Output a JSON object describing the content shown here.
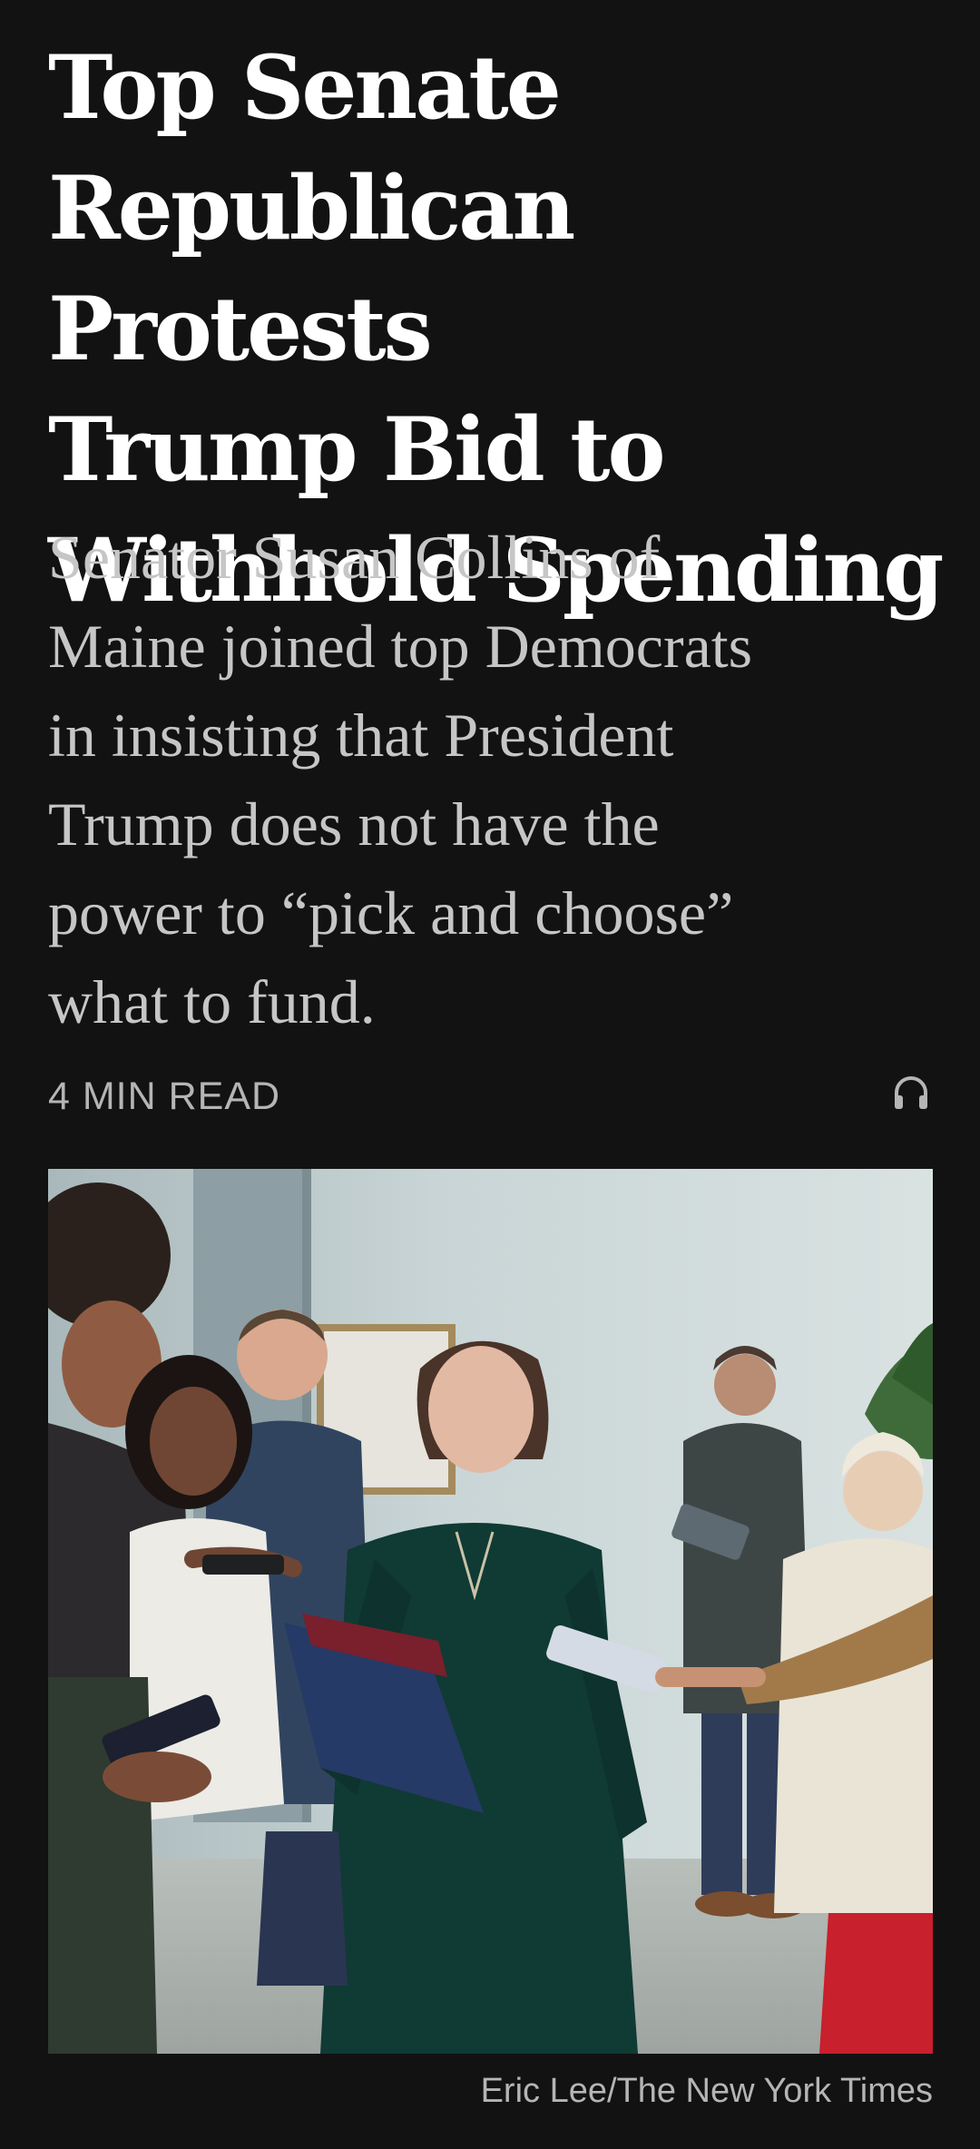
{
  "article": {
    "headline_lines": [
      "Top Senate",
      "Republican Protests",
      "Trump Bid to",
      "Withhold Spending"
    ],
    "summary_lines": [
      "Senator Susan Collins of",
      "Maine joined top Democrats",
      "in insisting that President",
      "Trump does not have the",
      "power to “pick and choose”",
      "what to fund."
    ],
    "read_time": "4 MIN READ",
    "listen_icon": "headphones-icon",
    "photo_credit": "Eric Lee/The New York Times"
  },
  "colors": {
    "background": "#121212",
    "headline": "#ffffff",
    "summary": "#c6c6c6",
    "meta": "#b5b5b5"
  }
}
